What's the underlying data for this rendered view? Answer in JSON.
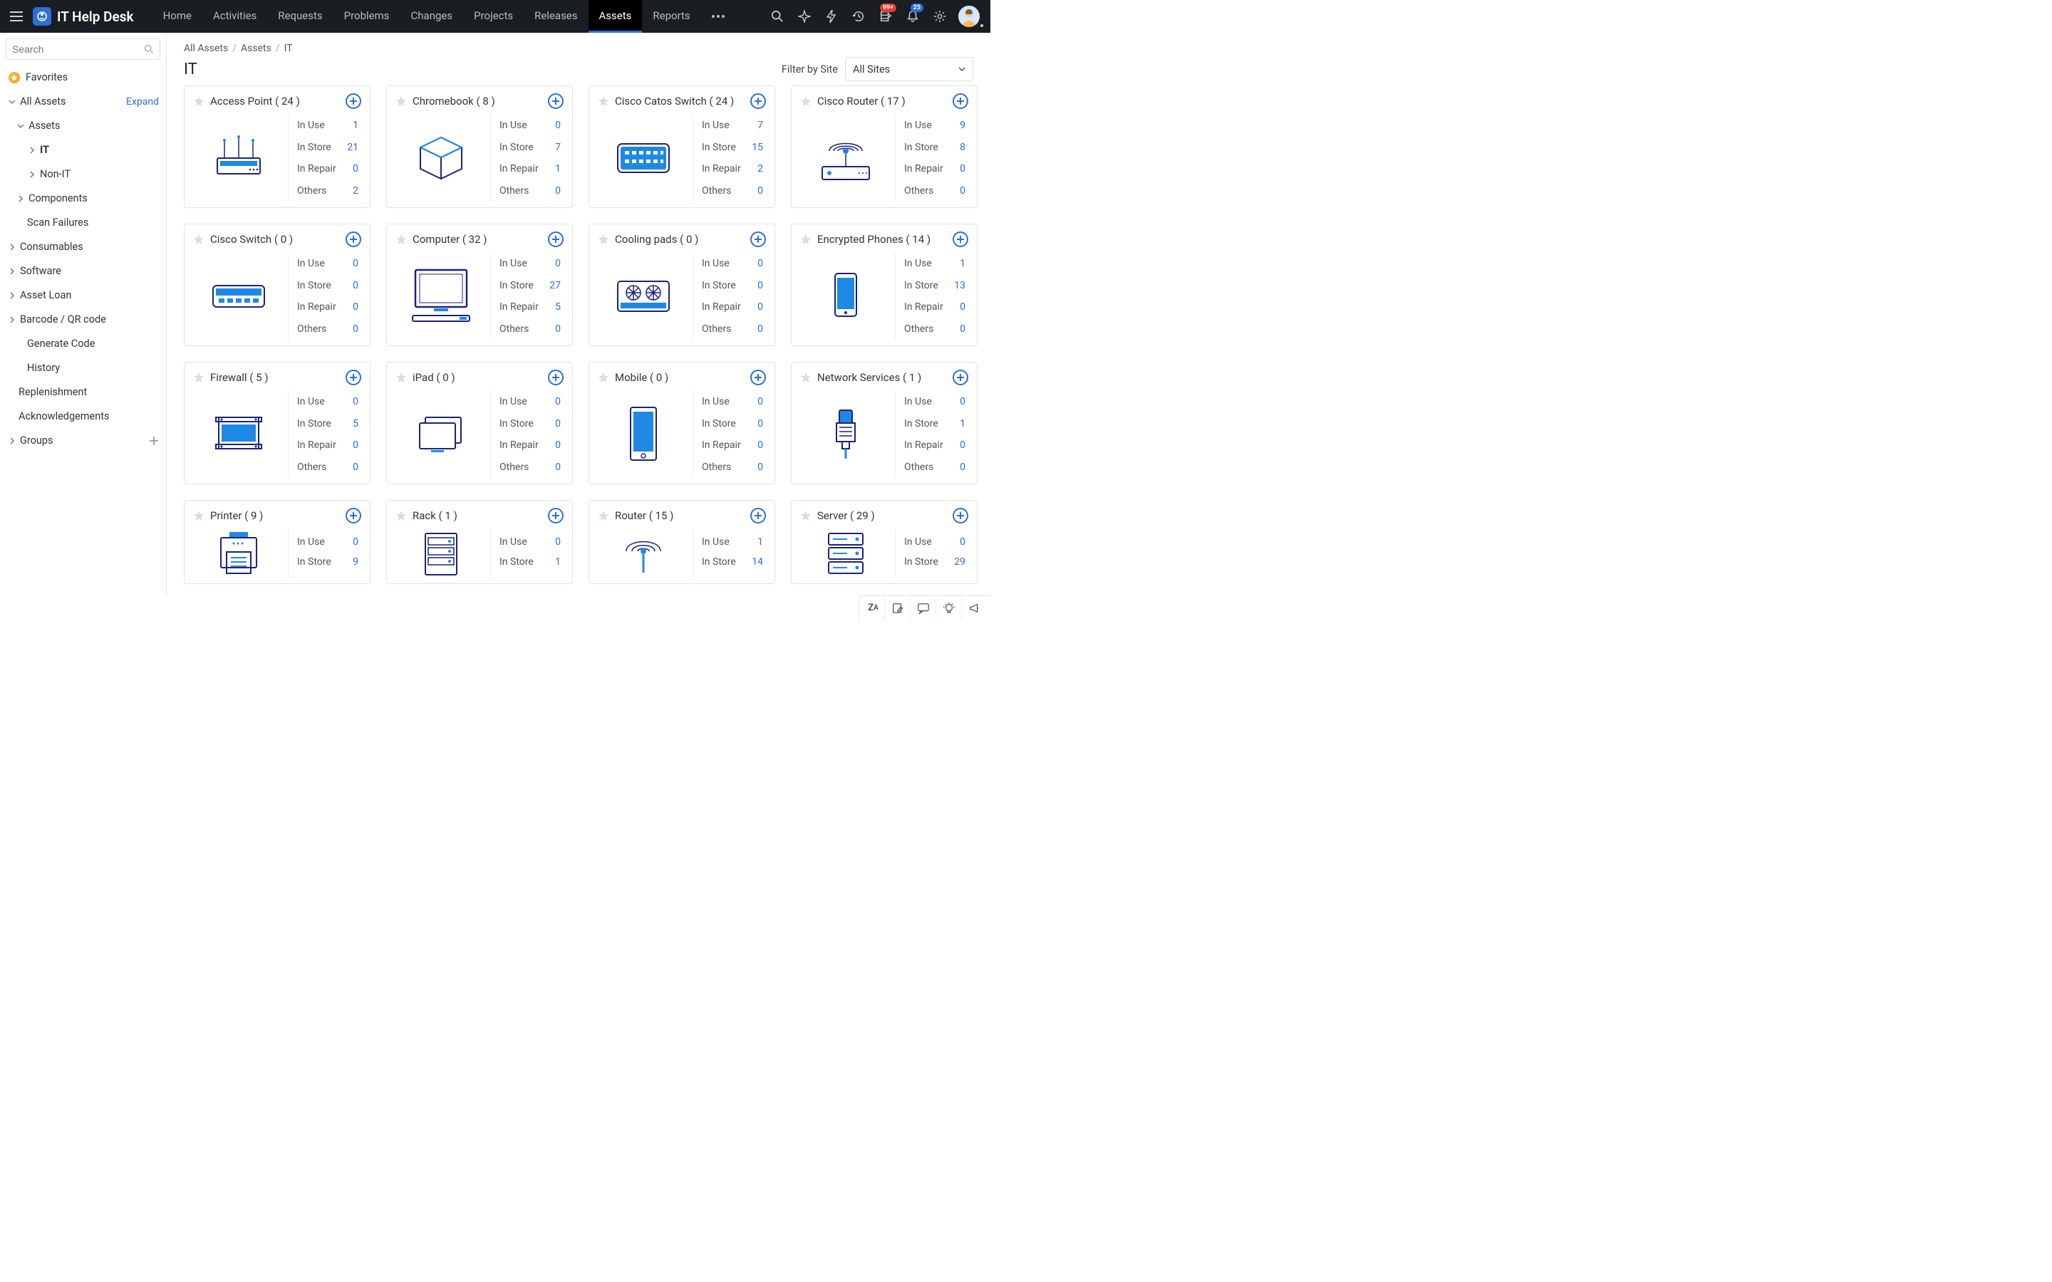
{
  "header": {
    "app_title": "IT Help Desk",
    "nav": [
      "Home",
      "Activities",
      "Requests",
      "Problems",
      "Changes",
      "Projects",
      "Releases",
      "Assets",
      "Reports"
    ],
    "nav_active": "Assets",
    "badge_inbox": "99+",
    "badge_bell": "25"
  },
  "sidebar": {
    "search_placeholder": "Search",
    "favorites": "Favorites",
    "all_assets": "All Assets",
    "expand_label": "Expand",
    "assets": "Assets",
    "it": "IT",
    "non_it": "Non-IT",
    "components": "Components",
    "scan_failures": "Scan Failures",
    "consumables": "Consumables",
    "software": "Software",
    "asset_loan": "Asset Loan",
    "barcode": "Barcode / QR code",
    "generate_code": "Generate Code",
    "history": "History",
    "replenishment": "Replenishment",
    "acknowledgements": "Acknowledgements",
    "groups": "Groups"
  },
  "breadcrumb": [
    "All Assets",
    "Assets",
    "IT"
  ],
  "page_title": "IT",
  "filter_label": "Filter by Site",
  "filter_value": "All Sites",
  "stat_labels": {
    "in_use": "In Use",
    "in_store": "In Store",
    "in_repair": "In Repair",
    "others": "Others"
  },
  "cards": [
    {
      "id": "access-point",
      "title": "Access Point ( 24 )",
      "icon": "router",
      "in_use": 1,
      "in_store": 21,
      "in_repair": 0,
      "others": 2
    },
    {
      "id": "chromebook",
      "title": "Chromebook ( 8 )",
      "icon": "cube",
      "in_use": 0,
      "in_store": 7,
      "in_repair": 1,
      "others": 0
    },
    {
      "id": "cisco-catos-switch",
      "title": "Cisco Catos Switch ( 24 )",
      "icon": "catos",
      "in_use": 7,
      "in_store": 15,
      "in_repair": 2,
      "others": 0
    },
    {
      "id": "cisco-router",
      "title": "Cisco Router ( 17 )",
      "icon": "wifi-router",
      "in_use": 9,
      "in_store": 8,
      "in_repair": 0,
      "others": 0
    },
    {
      "id": "cisco-switch",
      "title": "Cisco Switch ( 0 )",
      "icon": "switch",
      "in_use": 0,
      "in_store": 0,
      "in_repair": 0,
      "others": 0
    },
    {
      "id": "computer",
      "title": "Computer ( 32 )",
      "icon": "computer",
      "in_use": 0,
      "in_store": 27,
      "in_repair": 5,
      "others": 0
    },
    {
      "id": "cooling-pads",
      "title": "Cooling pads ( 0 )",
      "icon": "cooling",
      "in_use": 0,
      "in_store": 0,
      "in_repair": 0,
      "others": 0
    },
    {
      "id": "encrypted-phones",
      "title": "Encrypted Phones ( 14 )",
      "icon": "phone",
      "in_use": 1,
      "in_store": 13,
      "in_repair": 0,
      "others": 0
    },
    {
      "id": "firewall",
      "title": "Firewall ( 5 )",
      "icon": "firewall",
      "in_use": 0,
      "in_store": 5,
      "in_repair": 0,
      "others": 0
    },
    {
      "id": "ipad",
      "title": "iPad ( 0 )",
      "icon": "tablet",
      "in_use": 0,
      "in_store": 0,
      "in_repair": 0,
      "others": 0
    },
    {
      "id": "mobile",
      "title": "Mobile ( 0 )",
      "icon": "mobile",
      "in_use": 0,
      "in_store": 0,
      "in_repair": 0,
      "others": 0
    },
    {
      "id": "network-services",
      "title": "Network Services ( 1 )",
      "icon": "cable",
      "in_use": 0,
      "in_store": 1,
      "in_repair": 0,
      "others": 0
    },
    {
      "id": "printer",
      "title": "Printer ( 9 )",
      "icon": "printer",
      "in_use": 0,
      "in_store": 9
    },
    {
      "id": "rack",
      "title": "Rack ( 1 )",
      "icon": "rack",
      "in_use": 0,
      "in_store": 1
    },
    {
      "id": "router",
      "title": "Router ( 15 )",
      "icon": "router2",
      "in_use": 1,
      "in_store": 14
    },
    {
      "id": "server",
      "title": "Server ( 29 )",
      "icon": "server",
      "in_use": 0,
      "in_store": 29
    }
  ]
}
